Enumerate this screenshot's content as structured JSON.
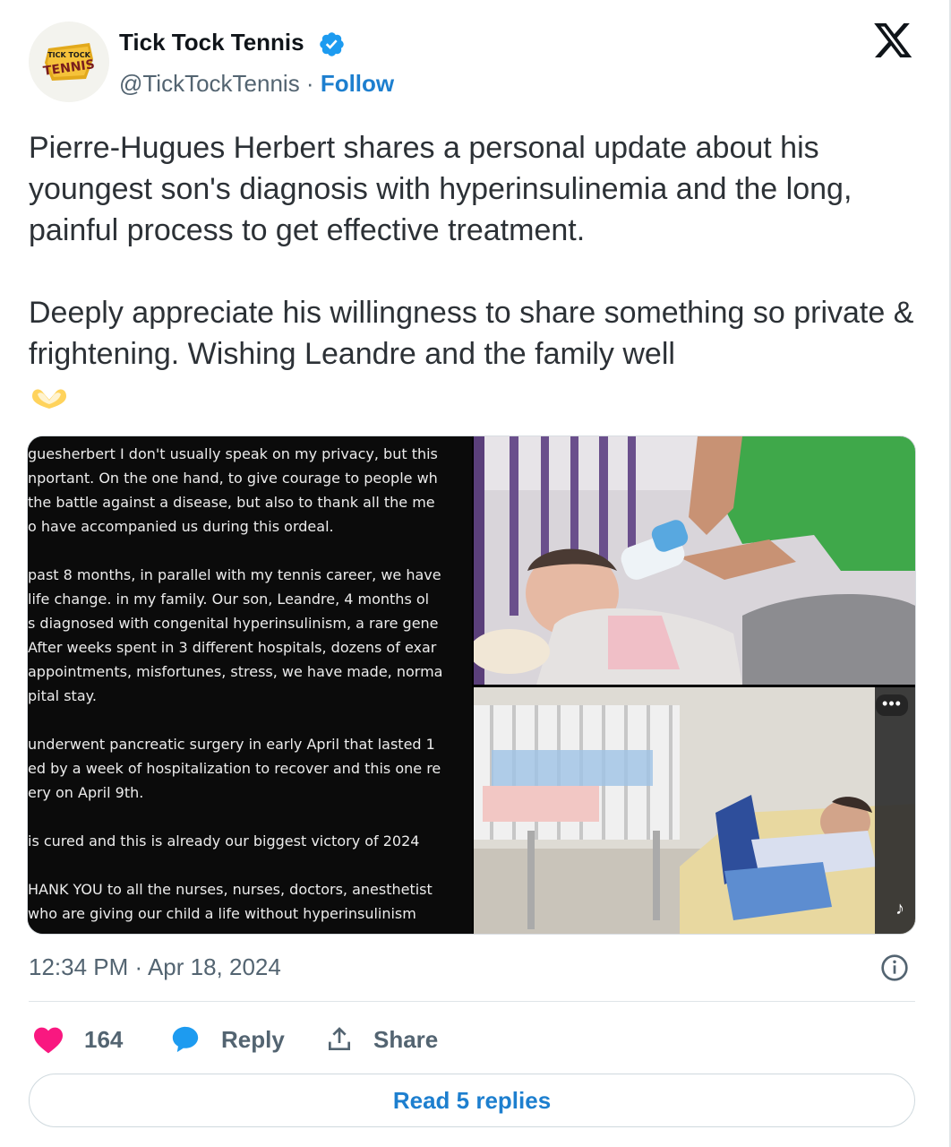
{
  "account": {
    "name": "Tick Tock Tennis",
    "handle": "@TickTockTennis",
    "separator": " · ",
    "follow_label": "Follow",
    "logo_text_top": "TICK TOCK",
    "logo_text_main": "TENNIS"
  },
  "tweet": {
    "paragraph_1": "Pierre-Hugues Herbert shares a personal update about his youngest son's diagnosis with hyperinsulinemia and the long, painful process to get effective treatment.",
    "paragraph_2": "Deeply appreciate his willingness to share something so private & frightening. Wishing Leandre and the family well",
    "emoji": "heart-hands-emoji"
  },
  "media": {
    "screenshot_lines": [
      "guesherbert I don't usually speak on my privacy, but this",
      "nportant. On the one hand, to give courage to people wh",
      "the battle against a disease, but also to thank all the me",
      "o have accompanied us during this ordeal.",
      "",
      "past 8 months, in parallel with my tennis career, we have",
      "life change. in my family. Our son, Leandre, 4 months ol",
      "s diagnosed with congenital hyperinsulinism, a rare gene",
      "After weeks spent in 3 different hospitals, dozens of exar",
      "appointments, misfortunes, stress, we have made, norma",
      "pital stay.",
      "",
      "underwent pancreatic surgery in early April that lasted 1",
      "ed by a week of hospitalization to recover and this one re",
      "ery on April 9th.",
      "",
      "is cured and this is already our biggest victory of 2024",
      "",
      "HANK YOU to all the nurses, nurses, doctors, anesthetist",
      "who are giving our child a life without hyperinsulinism"
    ],
    "more_label": "•••",
    "tiktok_glyph": "♪"
  },
  "meta": {
    "timestamp": "12:34 PM · Apr 18, 2024"
  },
  "actions": {
    "like_count": "164",
    "reply_label": "Reply",
    "share_label": "Share"
  },
  "footer": {
    "read_replies_label": "Read 5 replies"
  },
  "colors": {
    "accent": "#1d7fcf",
    "like": "#f91880",
    "reply_icon": "#1d9bf0",
    "muted": "#536471"
  }
}
